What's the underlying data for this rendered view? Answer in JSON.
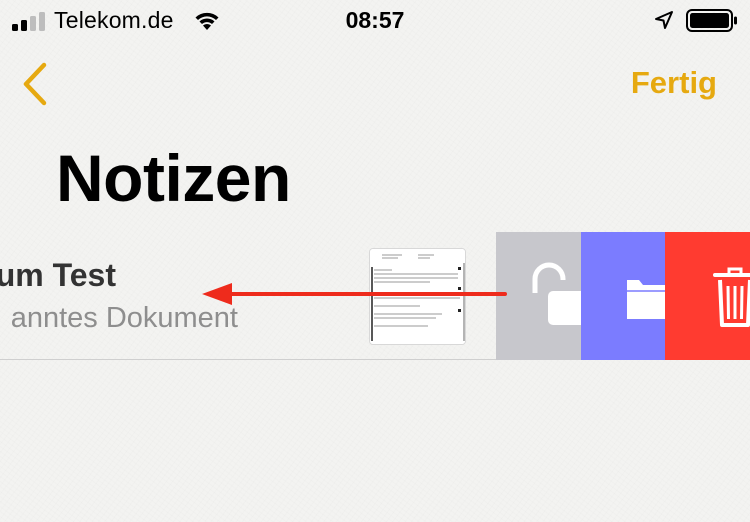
{
  "status_bar": {
    "carrier": "Telekom.de",
    "time": "08:57",
    "icons": [
      "signal-bars-icon",
      "wifi-icon",
      "location-arrow-icon",
      "battery-icon"
    ]
  },
  "nav": {
    "back_icon": "chevron-left-icon",
    "done_label": "Fertig",
    "accent_color": "#e6a910"
  },
  "page": {
    "title": "Notizen"
  },
  "note": {
    "title": "um Test",
    "subtitle": "anntes Dokument",
    "thumbnail": "document-thumbnail"
  },
  "swipe_actions": [
    {
      "name": "lock",
      "icon": "lock-icon",
      "color": "#c7c7cc"
    },
    {
      "name": "move-to-folder",
      "icon": "folder-icon",
      "color": "#7b7cff"
    },
    {
      "name": "delete",
      "icon": "trash-icon",
      "color": "#ff3b30"
    }
  ],
  "annotation": {
    "icon": "swipe-left-arrow-icon",
    "color": "#ee2b1c"
  }
}
